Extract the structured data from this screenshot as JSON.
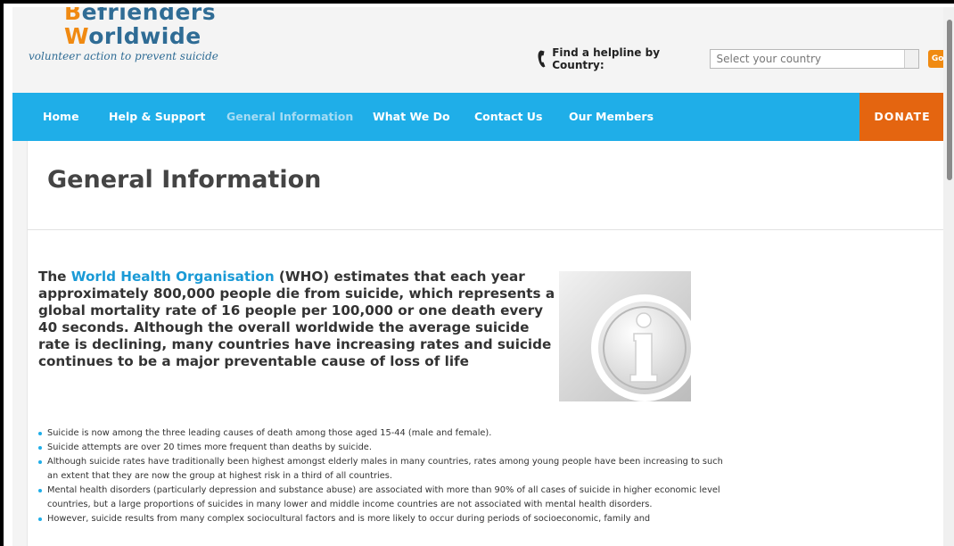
{
  "logo": {
    "line1_initial": "B",
    "line1_rest": "efrienders",
    "line2_initial": "W",
    "line2_rest": "orldwide",
    "tagline": "volunteer action to prevent suicide"
  },
  "helpline": {
    "label": "Find a helpline by Country:",
    "select_value": "Select your country",
    "go_label": "Go"
  },
  "nav": {
    "items": [
      "Home",
      "Help & Support",
      "General Information",
      "What We Do",
      "Contact Us",
      "Our Members"
    ],
    "active": "General Information",
    "donate_label": "DONATE"
  },
  "page": {
    "title": "General Information"
  },
  "lead": {
    "before": "The ",
    "link": "World Health Organisation",
    "after": " (WHO) estimates that each year approximately 800,000 people die from suicide, which represents a global mortality rate of 16 people per 100,000 or one death every 40 seconds. Although the overall worldwide the average suicide rate is declining, many countries have increasing rates and suicide continues to be a major preventable cause of loss of life"
  },
  "bullets": [
    "Suicide is now among the three leading causes of death among those aged 15-44 (male and female).",
    "Suicide attempts are over 20 times more frequent than deaths by suicide.",
    "Although suicide rates have traditionally been highest amongst elderly males in many countries, rates among young people have been increasing to such an extent that they are now the group at highest risk in a third of all countries.",
    "Mental health disorders (particularly depression and substance abuse) are associated with more than 90% of all cases of suicide in higher economic level countries, but a large proportions of suicides in many lower and middle income countries are not associated with mental health disorders.",
    "However, suicide results from many complex sociocultural factors and is more likely to occur during periods of socioeconomic, family and"
  ],
  "colors": {
    "nav_bg": "#1faee8",
    "donate_bg": "#e46510",
    "brand_orange": "#f08a12",
    "brand_blue": "#2f6c95",
    "link_blue": "#1a9ad6"
  },
  "icons": [
    "phone-icon",
    "info-icon",
    "chevron-down-icon"
  ]
}
